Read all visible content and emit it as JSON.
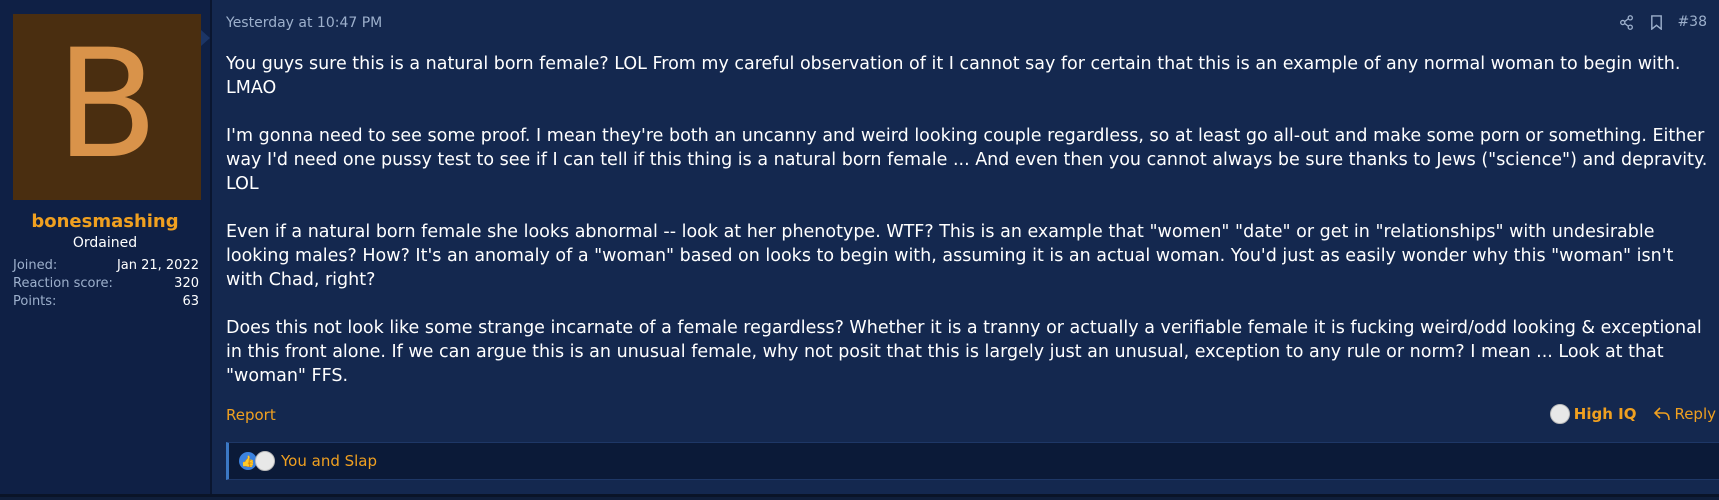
{
  "user": {
    "avatar_letter": "B",
    "username": "bonesmashing",
    "title": "Ordained",
    "stats": [
      {
        "label": "Joined:",
        "value": "Jan 21, 2022"
      },
      {
        "label": "Reaction score:",
        "value": "320"
      },
      {
        "label": "Points:",
        "value": "63"
      }
    ]
  },
  "post": {
    "date": "Yesterday at 10:47 PM",
    "number": "#38",
    "paragraphs": [
      "You guys sure this is a natural born female? LOL From my careful observation of it I cannot say for certain that this is an example of any normal woman to begin with. LMAO",
      "I'm gonna need to see some proof. I mean they're both an uncanny and weird looking couple regardless, so at least go all-out and make some porn or something. Either way I'd need one pussy test to see if I can tell if this thing is a natural born female ... And even then you cannot always be sure thanks to Jews (\"science\") and depravity. LOL",
      "Even if a natural born female she looks abnormal -- look at her phenotype. WTF? This is an example that \"women\" \"date\" or get in \"relationships\" with undesirable looking males? How? It's an anomaly of a \"woman\" based on looks to begin with, assuming it is an actual woman. You'd just as easily wonder why this \"woman\" isn't with Chad, right?",
      "Does this not look like some strange incarnate of a female regardless? Whether it is a tranny or actually a verifiable female it is fucking weird/odd looking & exceptional in this front alone. If we can argue this is an unusual female, why not posit that this is largely just an unusual, exception to any rule or norm? I mean ... Look at that \"woman\" FFS."
    ],
    "report_label": "Report",
    "reaction_label": "High IQ",
    "reply_label": "Reply",
    "reactions_summary": "You and Slap"
  },
  "colors": {
    "accent": "#f0a020",
    "background": "#14284f",
    "sidebar": "#0f2045",
    "avatar_bg": "#4a2e10",
    "avatar_letter": "#d9934a",
    "like_blue": "#3b82e0"
  }
}
